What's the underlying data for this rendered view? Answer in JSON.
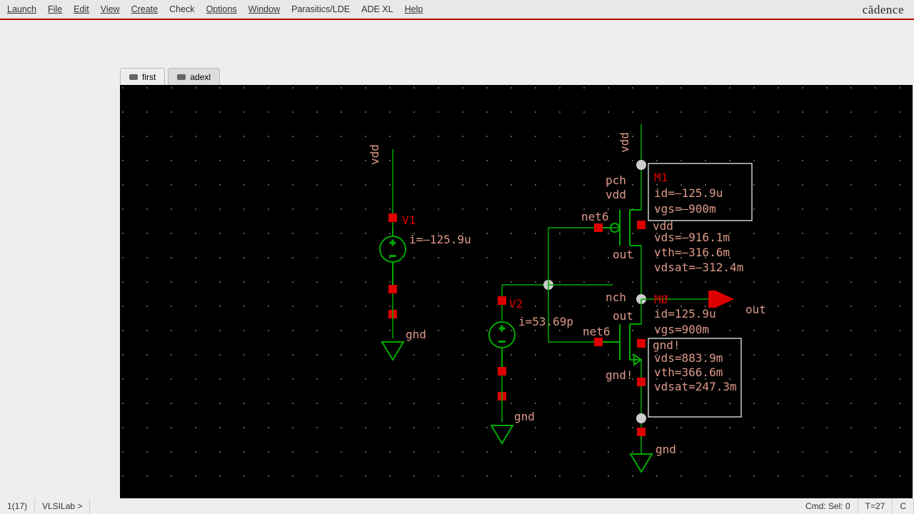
{
  "menu": {
    "launch": "Launch",
    "file": "File",
    "edit": "Edit",
    "view": "View",
    "create": "Create",
    "check": "Check",
    "options": "Options",
    "window": "Window",
    "parasitics": "Parasitics/LDE",
    "adexl": "ADE XL",
    "help": "Help"
  },
  "brand": "cādence",
  "tabs": [
    {
      "label": "first"
    },
    {
      "label": "adexl"
    }
  ],
  "status": {
    "left1": "1(17)",
    "prompt": "VLSILab >",
    "cmd": "Cmd: Sel: 0",
    "temp": "T=27",
    "unit": "C"
  },
  "sch": {
    "v1_name": "V1",
    "v1_anno": "i=–125.9u",
    "v2_name": "V2",
    "v2_anno": "i=53.69p",
    "labels": {
      "vdd_left": "vdd",
      "vdd_top": "vdd",
      "gnd_left": "gnd",
      "gnd_mid": "gnd",
      "gnd_right": "gnd",
      "net6_l": "net6",
      "net6_r": "net6",
      "pch": "pch",
      "nch": "nch",
      "vdd_b1": "vdd",
      "vdd_b2": "vdd",
      "out1": "out",
      "out2": "out",
      "gnd_b1": "gnd!",
      "gnd_b2": "gnd!",
      "out_port": "out"
    },
    "m1": {
      "name": "M1",
      "l1": "id=–125.9u",
      "l2": "vgs=–900m",
      "l3": "vds=–916.1m",
      "l4": "vth=–316.6m",
      "l5": "vdsat=–312.4m"
    },
    "m0": {
      "name": "MØ",
      "l1": "id=125.9u",
      "l2": "vgs=900m",
      "l3": "vds=883.9m",
      "l4": "vth=366.6m",
      "l5": "vdsat=247.3m"
    }
  }
}
